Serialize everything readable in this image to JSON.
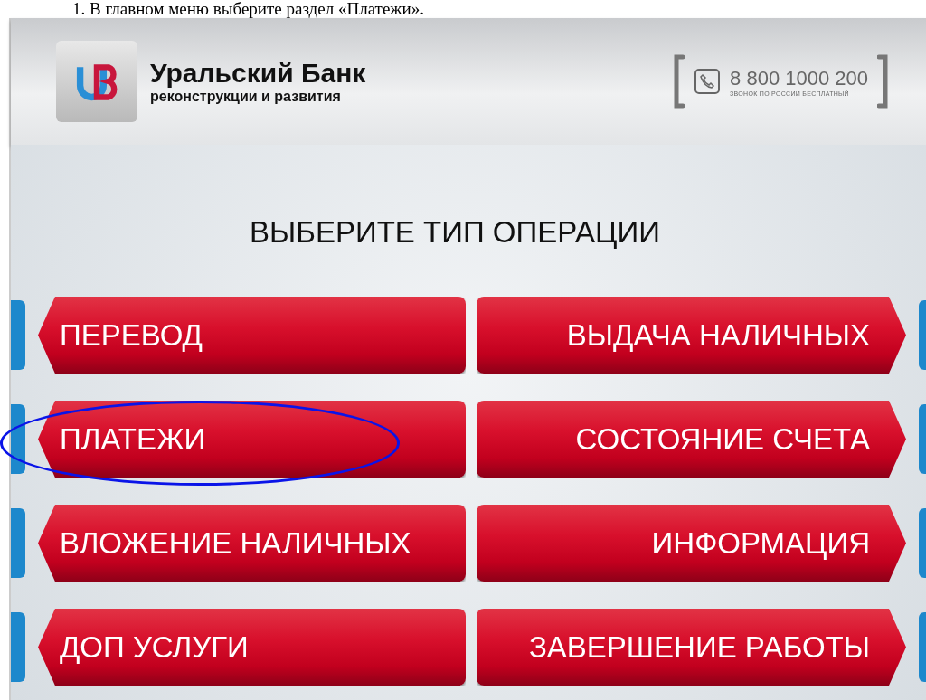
{
  "document_text": "1. В главном меню выберите раздел «Платежи».",
  "header": {
    "bank_name": "Уральский Банк",
    "bank_subtitle": "реконструкции и развития",
    "phone": "8 800 1000 200",
    "phone_note": "ЗВОНОК ПО РОССИИ БЕСПЛАТНЫЙ"
  },
  "title": "ВЫБЕРИТЕ ТИП ОПЕРАЦИИ",
  "buttons_left": [
    {
      "label": "ПЕРЕВОД",
      "highlighted": false
    },
    {
      "label": "ПЛАТЕЖИ",
      "highlighted": true
    },
    {
      "label": "ВЛОЖЕНИЕ НАЛИЧНЫХ",
      "highlighted": false
    },
    {
      "label": "ДОП УСЛУГИ",
      "highlighted": false
    }
  ],
  "buttons_right": [
    {
      "label": "ВЫДАЧА НАЛИЧНЫХ",
      "highlighted": false
    },
    {
      "label": "СОСТОЯНИЕ СЧЕТА",
      "highlighted": false
    },
    {
      "label": "ИНФОРМАЦИЯ",
      "highlighted": false
    },
    {
      "label": "ЗАВЕРШЕНИЕ РАБОТЫ",
      "highlighted": false
    }
  ]
}
